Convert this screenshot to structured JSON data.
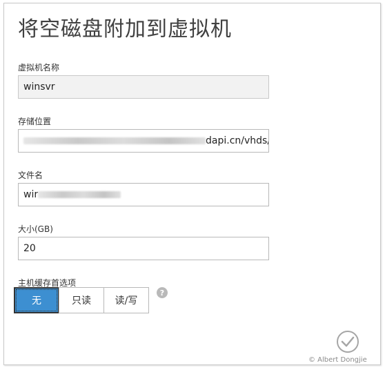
{
  "dialog": {
    "title": "将空磁盘附加到虚拟机"
  },
  "vm_name": {
    "label": "虚拟机名称",
    "value": "winsvr"
  },
  "storage_location": {
    "label": "存储位置",
    "value_suffix": "dapi.cn/vhds/"
  },
  "file_name": {
    "label": "文件名",
    "value_prefix": "wir"
  },
  "size": {
    "label": "大小(GB)",
    "value": "20"
  },
  "host_cache": {
    "label": "主机缓存首选项",
    "options": [
      "无",
      "只读",
      "读/写"
    ],
    "selected": "无",
    "help_icon_glyph": "?"
  },
  "icons": {
    "help": "help-icon",
    "confirm": "checkmark-icon"
  },
  "colors": {
    "selected_accent": "#3d8fd1"
  },
  "watermark": "© Albert Dongjie"
}
